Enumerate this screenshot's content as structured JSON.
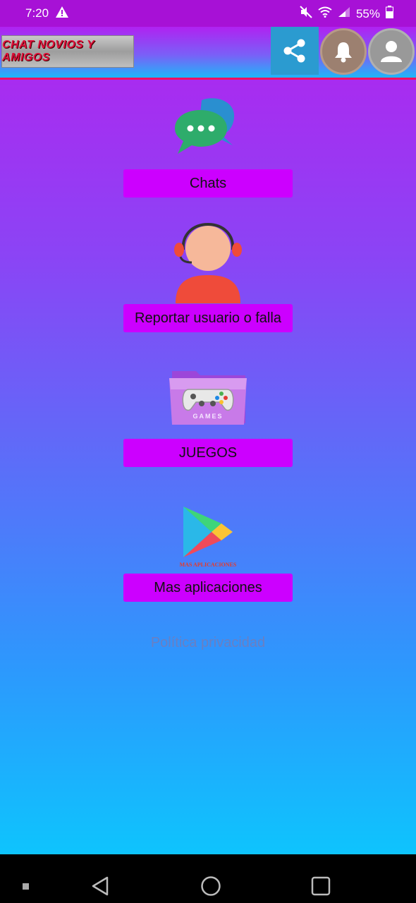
{
  "status_bar": {
    "time": "7:20",
    "battery": "55%"
  },
  "header": {
    "logo_text": "CHAT NOVIOS Y AMIGOS",
    "share_icon": "share-icon",
    "bell_icon": "bell-icon",
    "user_icon": "user-icon"
  },
  "menu": {
    "items": [
      {
        "label": "Chats",
        "icon": "chat-bubbles-icon"
      },
      {
        "label": "Reportar usuario o falla",
        "icon": "support-agent-icon"
      },
      {
        "label": "JUEGOS",
        "icon": "games-folder-icon",
        "icon_text": "GAMES"
      },
      {
        "label": "Mas aplicaciones",
        "icon": "play-store-icon",
        "icon_text": "MAS APLICACIONES"
      }
    ]
  },
  "privacy_link": "Política privacidad",
  "colors": {
    "status_bar": "#a711d6",
    "button_bg": "#cc00ff",
    "gradient_top": "#b521ee",
    "gradient_bottom": "#0ec4fd"
  }
}
